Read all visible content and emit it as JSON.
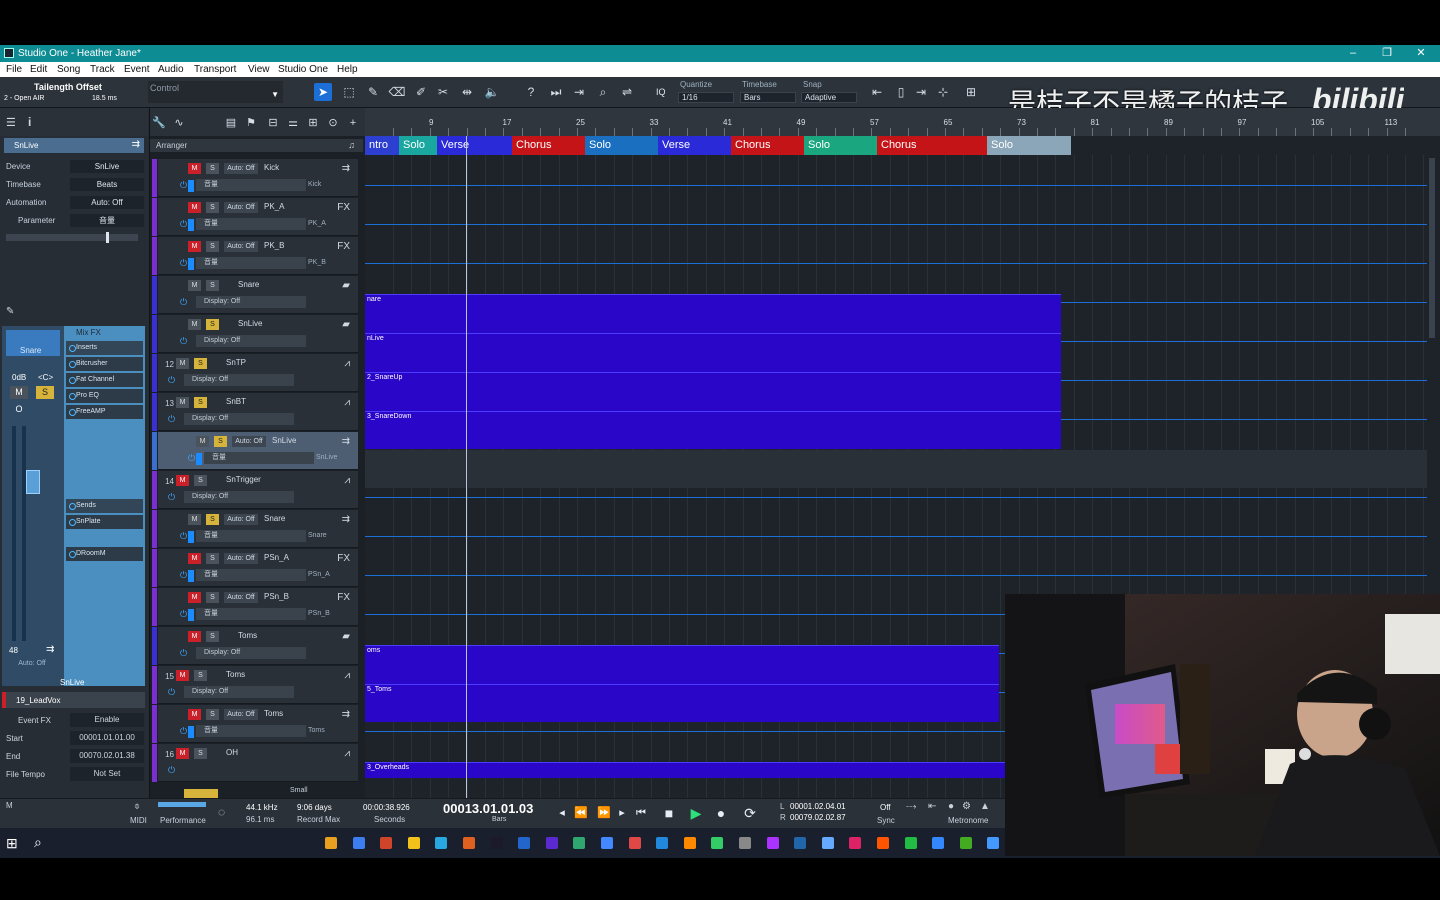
{
  "window": {
    "title": "Studio One - Heather Jane*",
    "min": "–",
    "max": "❐",
    "close": "✕"
  },
  "menu": [
    "File",
    "Edit",
    "Song",
    "Track",
    "Event",
    "Audio",
    "Transport",
    "View",
    "Studio One",
    "Help"
  ],
  "toolbar": {
    "device_name": "Tailength Offset",
    "device_sub": "2 - Open AIR",
    "device_ms": "18.5 ms",
    "control_label": "Control",
    "quantize_label": "Quantize",
    "quantize_value": "1/16",
    "timebase_label": "Timebase",
    "timebase_value": "Bars",
    "snap_label": "Snap",
    "snap_value": "Adaptive",
    "iq": "IQ"
  },
  "watermark": {
    "text": "是桔子不是橘子的桔子",
    "brand": "bilibili"
  },
  "inspector": {
    "track_name": "SnLive",
    "rows": [
      {
        "k": "Device",
        "v": "SnLive"
      },
      {
        "k": "Timebase",
        "v": "Beats"
      },
      {
        "k": "Automation",
        "v": "Auto: Off"
      },
      {
        "k": "Parameter",
        "v": "音量"
      }
    ],
    "strip_name": "Snare",
    "gain": "0dB",
    "pan": "<C>",
    "fader_value": "48",
    "strip_auto": "Auto: Off",
    "channel_label": "SnLive",
    "mixfx": "Mix FX",
    "inserts_label": "Inserts",
    "inserts": [
      "Bitcrusher",
      "Fat Channel",
      "Pro EQ",
      "FreeAMP"
    ],
    "sends_label": "Sends",
    "sends": [
      "SnPlate",
      "DRoomM"
    ],
    "event_track": "19_LeadVox",
    "event_fx": "Event FX",
    "enable": "Enable",
    "start_label": "Start",
    "start": "00001.01.01.00",
    "end_label": "End",
    "end": "00070.02.01.38",
    "file_tempo_label": "File Tempo",
    "file_tempo": "Not Set"
  },
  "arranger_label": "Arranger",
  "tracks": [
    {
      "num": "",
      "name": "Kick",
      "sub": "Kick",
      "m": true,
      "s": false,
      "auto": "Auto: Off",
      "disp": "音量",
      "icon": "⇉",
      "color": "#7b2fd0"
    },
    {
      "num": "",
      "name": "PK_A",
      "sub": "PK_A",
      "m": true,
      "s": false,
      "auto": "Auto: Off",
      "disp": "音量",
      "icon": "FX",
      "color": "#7b2fd0"
    },
    {
      "num": "",
      "name": "PK_B",
      "sub": "PK_B",
      "m": true,
      "s": false,
      "auto": "Auto: Off",
      "disp": "音量",
      "icon": "FX",
      "color": "#7b2fd0"
    },
    {
      "num": "",
      "name": "Snare",
      "sub": "",
      "m": false,
      "s": false,
      "auto": "",
      "disp": "Display: Off",
      "icon": "▰",
      "color": "#3a2fd0"
    },
    {
      "num": "",
      "name": "SnLive",
      "sub": "",
      "m": false,
      "s": true,
      "auto": "",
      "disp": "Display: Off",
      "icon": "▰",
      "color": "#3a2fd0"
    },
    {
      "num": "12",
      "name": "SnTP",
      "sub": "",
      "m": false,
      "s": true,
      "auto": "",
      "disp": "Display: Off",
      "icon": "⩘",
      "color": "#3a2fd0"
    },
    {
      "num": "13",
      "name": "SnBT",
      "sub": "",
      "m": false,
      "s": true,
      "auto": "",
      "disp": "Display: Off",
      "icon": "⩘",
      "color": "#3a2fd0"
    },
    {
      "num": "",
      "name": "SnLive",
      "sub": "SnLive",
      "m": false,
      "s": true,
      "auto": "Auto: Off",
      "disp": "音量",
      "icon": "⇉",
      "color": "#3a6fd0",
      "sel": true
    },
    {
      "num": "14",
      "name": "SnTrigger",
      "sub": "",
      "m": true,
      "s": false,
      "auto": "",
      "disp": "Display: Off",
      "icon": "⩘",
      "color": "#7b2fd0"
    },
    {
      "num": "",
      "name": "Snare",
      "sub": "Snare",
      "m": false,
      "s": true,
      "auto": "Auto: Off",
      "disp": "音量",
      "icon": "⇉",
      "color": "#7b2fd0"
    },
    {
      "num": "",
      "name": "PSn_A",
      "sub": "PSn_A",
      "m": true,
      "s": false,
      "auto": "Auto: Off",
      "disp": "音量",
      "icon": "FX",
      "color": "#7b2fd0"
    },
    {
      "num": "",
      "name": "PSn_B",
      "sub": "PSn_B",
      "m": true,
      "s": false,
      "auto": "Auto: Off",
      "disp": "音量",
      "icon": "FX",
      "color": "#7b2fd0"
    },
    {
      "num": "",
      "name": "Toms",
      "sub": "",
      "m": true,
      "s": false,
      "auto": "",
      "disp": "Display: Off",
      "icon": "▰",
      "color": "#3a2fd0"
    },
    {
      "num": "15",
      "name": "Toms",
      "sub": "",
      "m": true,
      "s": false,
      "auto": "",
      "disp": "Display: Off",
      "icon": "⩘",
      "color": "#7b2fd0"
    },
    {
      "num": "",
      "name": "Toms",
      "sub": "Toms",
      "m": true,
      "s": false,
      "auto": "Auto: Off",
      "disp": "音量",
      "icon": "⇉",
      "color": "#7b2fd0"
    },
    {
      "num": "16",
      "name": "OH",
      "sub": "",
      "m": true,
      "s": false,
      "auto": "",
      "disp": "",
      "icon": "⩘",
      "color": "#7b2fd0"
    }
  ],
  "ruler": [
    "9",
    "17",
    "25",
    "33",
    "41",
    "49",
    "57",
    "65",
    "73",
    "81",
    "89",
    "97",
    "105",
    "113"
  ],
  "sections": [
    {
      "label": "ntro",
      "color": "#2d3fd0"
    },
    {
      "label": "Solo",
      "color": "#1aa7a0"
    },
    {
      "label": "Verse",
      "color": "#2a2ad8"
    },
    {
      "label": "Chorus",
      "color": "#c41418"
    },
    {
      "label": "Solo",
      "color": "#1a6fc0"
    },
    {
      "label": "Verse",
      "color": "#2a2ad8"
    },
    {
      "label": "Chorus",
      "color": "#c41418"
    },
    {
      "label": "Solo",
      "color": "#1aa780"
    },
    {
      "label": "Chorus",
      "color": "#c41418"
    },
    {
      "label": "Solo",
      "color": "#8aa6b8"
    }
  ],
  "clips": [
    "nare",
    "nLive",
    "2_SnareUp",
    "3_SnareDown",
    "oms",
    "5_Toms",
    "3_Overheads"
  ],
  "transport": {
    "midi": "MIDI",
    "performance": "Performance",
    "sample_rate": "44.1 kHz",
    "latency": "96.1 ms",
    "days": "9:06 days",
    "record_max": "Record Max",
    "seconds": "00:00:38.926",
    "seconds_label": "Seconds",
    "position": "00013.01.01.03",
    "bars_label": "Bars",
    "loop_l": "00001.02.04.01",
    "loop_r": "00079.02.02.87",
    "l": "L",
    "r": "R",
    "sync": "Off",
    "sync_label": "Sync",
    "metronome": "Metronome",
    "m_label": "M",
    "small_label": "Small"
  }
}
